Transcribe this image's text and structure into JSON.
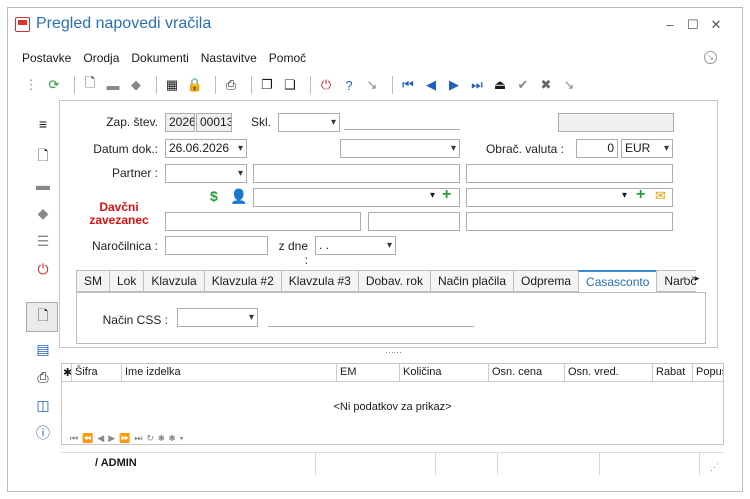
{
  "window": {
    "title": "Pregled napovedi vračila"
  },
  "menu": [
    "Postavke",
    "Orodja",
    "Dokumenti",
    "Nastavitve",
    "Pomoč"
  ],
  "form": {
    "zap_label": "Zap. štev.",
    "zap_year": "2026",
    "zap_num": "00013",
    "skl_label": "Skl.",
    "datum_label": "Datum dok.:",
    "datum_value": "26.06.2026",
    "valuta_label": "Obrač. valuta :",
    "valuta_rate": "0",
    "valuta_code": "EUR",
    "partner_label": "Partner :",
    "davcni_label": "Davčni zavezanec",
    "narocilnica_label": "Naročilnica :",
    "dne_label": "z dne :",
    "dne_value": ". ."
  },
  "tabs": [
    "SM",
    "Lok",
    "Klavzula",
    "Klavzula #2",
    "Klavzula #3",
    "Dobav. rok",
    "Način plačila",
    "Odprema",
    "Casasconto",
    "Naroč"
  ],
  "active_tab": "Casasconto",
  "tab_content": {
    "css_label": "Način CSS :"
  },
  "grid": {
    "columns": [
      "✱",
      "Šifra",
      "Ime izdelka",
      "EM",
      "Količina",
      "Osn. cena",
      "Osn. vred.",
      "Rabat",
      "Popus"
    ],
    "empty_text": "<Ni podatkov za prikaz>"
  },
  "status": {
    "user": "/ ADMIN"
  }
}
